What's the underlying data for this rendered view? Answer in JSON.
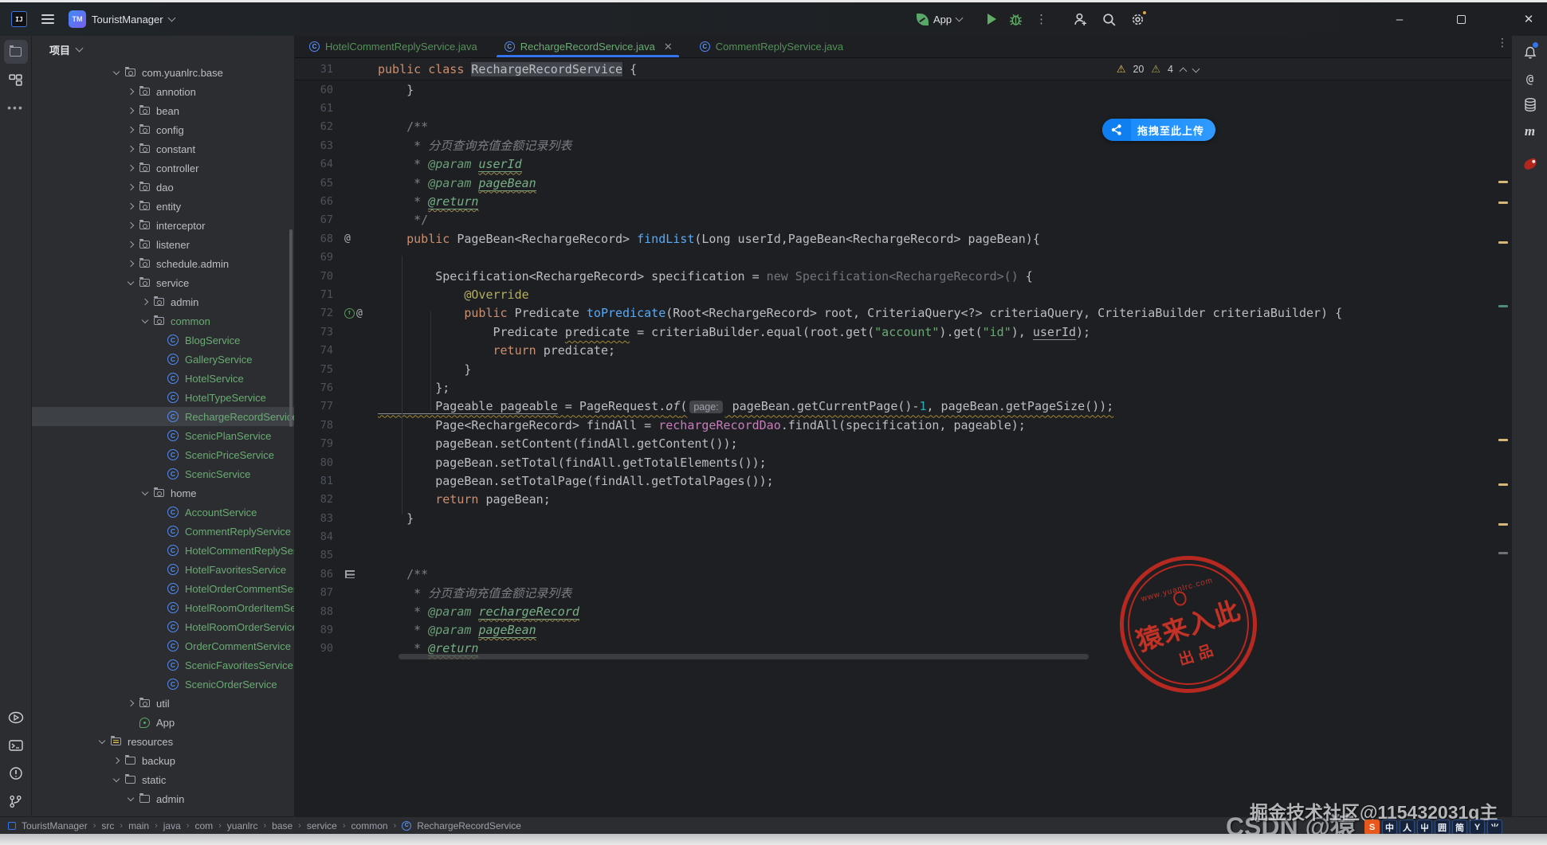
{
  "titlebar": {
    "ide_logo": "IJ",
    "project_initials": "TM",
    "project_name": "TouristManager",
    "run_config": "App",
    "minimize": "–",
    "maximize": "",
    "close": "✕"
  },
  "left_strip": {
    "top": [
      "project-folder",
      "structure",
      "more"
    ],
    "bottom": [
      "services",
      "terminal",
      "problems",
      "git-branch"
    ]
  },
  "project_panel": {
    "header": "项目",
    "items": [
      {
        "label": "com.yuanlrc.base",
        "level": 5,
        "kind": "pkg",
        "chev": "down"
      },
      {
        "label": "annotion",
        "level": 6,
        "kind": "pkg",
        "chev": "right"
      },
      {
        "label": "bean",
        "level": 6,
        "kind": "pkg",
        "chev": "right"
      },
      {
        "label": "config",
        "level": 6,
        "kind": "pkg",
        "chev": "right"
      },
      {
        "label": "constant",
        "level": 6,
        "kind": "pkg",
        "chev": "right"
      },
      {
        "label": "controller",
        "level": 6,
        "kind": "pkg",
        "chev": "right"
      },
      {
        "label": "dao",
        "level": 6,
        "kind": "pkg",
        "chev": "right"
      },
      {
        "label": "entity",
        "level": 6,
        "kind": "pkg",
        "chev": "right"
      },
      {
        "label": "interceptor",
        "level": 6,
        "kind": "pkg",
        "chev": "right"
      },
      {
        "label": "listener",
        "level": 6,
        "kind": "pkg",
        "chev": "right"
      },
      {
        "label": "schedule.admin",
        "level": 6,
        "kind": "pkg",
        "chev": "right"
      },
      {
        "label": "service",
        "level": 6,
        "kind": "pkg",
        "chev": "down"
      },
      {
        "label": "admin",
        "level": 7,
        "kind": "pkg",
        "chev": "right"
      },
      {
        "label": "common",
        "level": 7,
        "kind": "pkg",
        "chev": "down",
        "green": true
      },
      {
        "label": "BlogService",
        "level": 8,
        "kind": "class",
        "green": true
      },
      {
        "label": "GalleryService",
        "level": 8,
        "kind": "class",
        "green": true
      },
      {
        "label": "HotelService",
        "level": 8,
        "kind": "class",
        "green": true
      },
      {
        "label": "HotelTypeService",
        "level": 8,
        "kind": "class",
        "green": true
      },
      {
        "label": "RechargeRecordService",
        "level": 8,
        "kind": "class",
        "green": true,
        "selected": true
      },
      {
        "label": "ScenicPlanService",
        "level": 8,
        "kind": "class",
        "green": true
      },
      {
        "label": "ScenicPriceService",
        "level": 8,
        "kind": "class",
        "green": true
      },
      {
        "label": "ScenicService",
        "level": 8,
        "kind": "class",
        "green": true
      },
      {
        "label": "home",
        "level": 7,
        "kind": "pkg",
        "chev": "down"
      },
      {
        "label": "AccountService",
        "level": 8,
        "kind": "class",
        "green": true
      },
      {
        "label": "CommentReplyService",
        "level": 8,
        "kind": "class",
        "green": true
      },
      {
        "label": "HotelCommentReplyService",
        "level": 8,
        "kind": "class",
        "green": true
      },
      {
        "label": "HotelFavoritesService",
        "level": 8,
        "kind": "class",
        "green": true
      },
      {
        "label": "HotelOrderCommentService",
        "level": 8,
        "kind": "class",
        "green": true
      },
      {
        "label": "HotelRoomOrderItemService",
        "level": 8,
        "kind": "class",
        "green": true
      },
      {
        "label": "HotelRoomOrderService",
        "level": 8,
        "kind": "class",
        "green": true
      },
      {
        "label": "OrderCommentService",
        "level": 8,
        "kind": "class",
        "green": true
      },
      {
        "label": "ScenicFavoritesService",
        "level": 8,
        "kind": "class",
        "green": true
      },
      {
        "label": "ScenicOrderService",
        "level": 8,
        "kind": "class",
        "green": true
      },
      {
        "label": "util",
        "level": 6,
        "kind": "pkg",
        "chev": "right"
      },
      {
        "label": "App",
        "level": 6,
        "kind": "app"
      },
      {
        "label": "resources",
        "level": 4,
        "kind": "res",
        "chev": "down"
      },
      {
        "label": "backup",
        "level": 5,
        "kind": "folder",
        "chev": "right"
      },
      {
        "label": "static",
        "level": 5,
        "kind": "folder",
        "chev": "down"
      },
      {
        "label": "admin",
        "level": 6,
        "kind": "folder",
        "chev": "down"
      }
    ]
  },
  "tabs": [
    {
      "label": "HotelCommentReplyService.java",
      "active": false,
      "closable": false
    },
    {
      "label": "RechargeRecordService.java",
      "active": true,
      "closable": true
    },
    {
      "label": "CommentReplyService.java",
      "active": false,
      "closable": false
    }
  ],
  "editor": {
    "inspection": {
      "warnings": "20",
      "weak_warnings": "4"
    },
    "sticky": {
      "n": "31",
      "segs": [
        [
          "k",
          "public class "
        ],
        [
          "d hl",
          "RechargeRecordService"
        ],
        [
          "d",
          " {"
        ]
      ]
    },
    "lines": [
      {
        "n": "60",
        "segs": [
          [
            "d",
            "    }"
          ]
        ]
      },
      {
        "n": "61",
        "segs": []
      },
      {
        "n": "62",
        "segs": [
          [
            "c",
            "    /**"
          ]
        ]
      },
      {
        "n": "63",
        "segs": [
          [
            "c",
            "     * "
          ],
          [
            "ci",
            "分页查询充值金额记录列表"
          ]
        ]
      },
      {
        "n": "64",
        "segs": [
          [
            "c",
            "     * "
          ],
          [
            "ct",
            "@param "
          ],
          [
            "cr",
            "userId"
          ]
        ]
      },
      {
        "n": "65",
        "segs": [
          [
            "c",
            "     * "
          ],
          [
            "ct",
            "@param "
          ],
          [
            "cr",
            "pageBean"
          ]
        ]
      },
      {
        "n": "66",
        "segs": [
          [
            "c",
            "     * "
          ],
          [
            "cr",
            "@return"
          ]
        ]
      },
      {
        "n": "67",
        "segs": [
          [
            "c",
            "     */"
          ]
        ]
      },
      {
        "n": "68",
        "gutter": "at",
        "segs": [
          [
            "d",
            "    "
          ],
          [
            "k",
            "public "
          ],
          [
            "d",
            "PageBean<RechargeRecord> "
          ],
          [
            "f",
            "findList"
          ],
          [
            "d",
            "(Long userId,PageBean<RechargeRecord> pageBean){"
          ]
        ]
      },
      {
        "n": "69",
        "segs": []
      },
      {
        "n": "70",
        "segs": [
          [
            "d",
            "        Specification<RechargeRecord> specification = "
          ],
          [
            "g",
            "new Specification<RechargeRecord>() "
          ],
          [
            "d",
            "{"
          ]
        ]
      },
      {
        "n": "71",
        "segs": [
          [
            "a",
            "            @Override"
          ]
        ]
      },
      {
        "n": "72",
        "gutter": "ovr",
        "segs": [
          [
            "d",
            "            "
          ],
          [
            "k",
            "public "
          ],
          [
            "d",
            "Predicate "
          ],
          [
            "f",
            "toPredicate"
          ],
          [
            "d",
            "(Root<RechargeRecord> root, CriteriaQuery<?> criteriaQuery, CriteriaBuilder criteriaBuilder) {"
          ]
        ]
      },
      {
        "n": "73",
        "segs": [
          [
            "d",
            "                Predicate "
          ],
          [
            "d w",
            "predicate"
          ],
          [
            "d",
            " = criteriaBuilder.equal(root.get("
          ],
          [
            "s",
            "\"account\""
          ],
          [
            "d",
            ").get("
          ],
          [
            "s",
            "\"id\""
          ],
          [
            "d",
            "), "
          ],
          [
            "d u",
            "userId"
          ],
          [
            "d",
            ");"
          ]
        ]
      },
      {
        "n": "74",
        "segs": [
          [
            "d",
            "                "
          ],
          [
            "k",
            "return "
          ],
          [
            "d",
            "predicate;"
          ]
        ]
      },
      {
        "n": "75",
        "segs": [
          [
            "d",
            "            }"
          ]
        ]
      },
      {
        "n": "76",
        "segs": [
          [
            "d",
            "        };"
          ]
        ]
      },
      {
        "n": "77",
        "segs": [
          [
            "d w u",
            "        Pageable pageable"
          ],
          [
            "d w",
            " = PageRequest."
          ],
          [
            "d w i",
            "of"
          ],
          [
            "d w",
            "("
          ],
          [
            "hint",
            "page:"
          ],
          [
            "d w",
            " pageBean.getCurrentPage()-"
          ],
          [
            "n w",
            "1"
          ],
          [
            "d w",
            ", pageBean.getPageSize());"
          ]
        ]
      },
      {
        "n": "78",
        "segs": [
          [
            "d",
            "        Page<RechargeRecord> findAll = "
          ],
          [
            "fl",
            "rechargeRecordDao"
          ],
          [
            "d",
            ".findAll(specification, pageable);"
          ]
        ]
      },
      {
        "n": "79",
        "segs": [
          [
            "d",
            "        pageBean.setContent(findAll.getContent());"
          ]
        ]
      },
      {
        "n": "80",
        "segs": [
          [
            "d",
            "        pageBean.setTotal(findAll.getTotalElements());"
          ]
        ]
      },
      {
        "n": "81",
        "segs": [
          [
            "d",
            "        pageBean.setTotalPage(findAll.getTotalPages());"
          ]
        ]
      },
      {
        "n": "82",
        "segs": [
          [
            "d",
            "        "
          ],
          [
            "k",
            "return "
          ],
          [
            "d",
            "pageBean;"
          ]
        ]
      },
      {
        "n": "83",
        "segs": [
          [
            "d",
            "    }"
          ]
        ]
      },
      {
        "n": "84",
        "segs": []
      },
      {
        "n": "85",
        "segs": []
      },
      {
        "n": "86",
        "gutter": "fmt",
        "segs": [
          [
            "c",
            "    /**"
          ]
        ]
      },
      {
        "n": "87",
        "segs": [
          [
            "c",
            "     * "
          ],
          [
            "ci",
            "分页查询充值金额记录列表"
          ]
        ]
      },
      {
        "n": "88",
        "segs": [
          [
            "c",
            "     * "
          ],
          [
            "ct",
            "@param "
          ],
          [
            "cr",
            "rechargeRecord"
          ]
        ]
      },
      {
        "n": "89",
        "segs": [
          [
            "c",
            "     * "
          ],
          [
            "ct",
            "@param "
          ],
          [
            "cr",
            "pageBean"
          ]
        ]
      },
      {
        "n": "90",
        "segs": [
          [
            "c",
            "     * "
          ],
          [
            "cr",
            "@return"
          ]
        ]
      }
    ]
  },
  "breadcrumbs": [
    "TouristManager",
    "src",
    "main",
    "java",
    "com",
    "yuanlrc",
    "base",
    "service",
    "common",
    "RechargeRecordService"
  ],
  "overlays": {
    "upload_button": "拖拽至此上传",
    "stamp": {
      "url": "www.yuanlrc.com",
      "main": "猿来入此",
      "sub": "出品"
    },
    "watermark_juejin": "掘金技术社区@115432031g主",
    "watermark_csdn": "CSDN @猿",
    "ime_keys": [
      "S",
      "中",
      "人",
      "屮",
      "囲",
      "简",
      "Y",
      "⺌"
    ]
  }
}
